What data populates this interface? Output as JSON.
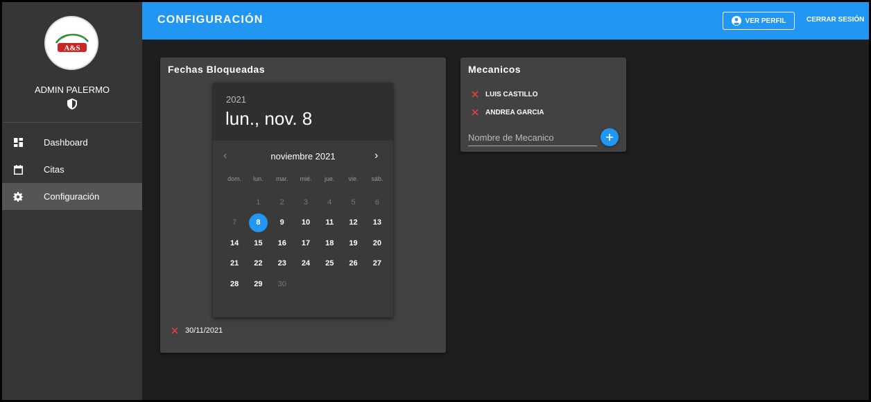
{
  "sidebar": {
    "logo_text": "A&S",
    "user_name": "ADMIN PALERMO",
    "items": [
      {
        "label": "Dashboard",
        "icon": "dashboard-icon"
      },
      {
        "label": "Citas",
        "icon": "calendar-icon"
      },
      {
        "label": "Configuración",
        "icon": "gear-icon",
        "active": true
      }
    ]
  },
  "header": {
    "title": "CONFIGURACIÓN",
    "profile_label": "VER PERFIL",
    "logout_label": "CERRAR SESIÓN",
    "color": "#2196f3"
  },
  "fechas": {
    "title": "Fechas Bloqueadas",
    "picker": {
      "year": "2021",
      "selected_date": "lun., nov. 8",
      "month_label": "noviembre 2021",
      "weekdays": [
        "dom.",
        "lun.",
        "mar.",
        "mié.",
        "jue.",
        "vie.",
        "sáb."
      ],
      "weeks": [
        [
          "",
          "1",
          "2",
          "3",
          "4",
          "5",
          "6"
        ],
        [
          "7",
          "8",
          "9",
          "10",
          "11",
          "12",
          "13"
        ],
        [
          "14",
          "15",
          "16",
          "17",
          "18",
          "19",
          "20"
        ],
        [
          "21",
          "22",
          "23",
          "24",
          "25",
          "26",
          "27"
        ],
        [
          "28",
          "29",
          "30",
          "",
          "",
          "",
          ""
        ]
      ],
      "selected_day": "8"
    },
    "blocked": [
      "30/11/2021"
    ]
  },
  "mecanicos": {
    "title": "Mecanicos",
    "list": [
      "LUIS CASTILLO",
      "ANDREA GARCIA"
    ],
    "input_placeholder": "Nombre de Mecanico",
    "accent": "#f44336"
  }
}
